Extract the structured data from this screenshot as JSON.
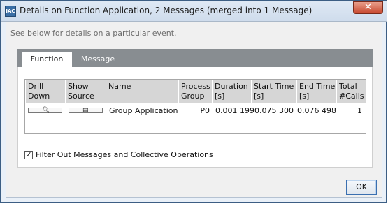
{
  "window": {
    "title": "Details on Function Application, 2 Messages (merged into 1 Message)",
    "app_icon_label": "IAC",
    "close_label": "✕"
  },
  "hint": "See below for details on a particular event.",
  "tabs": [
    {
      "label": "Function",
      "active": true
    },
    {
      "label": "Message",
      "active": false
    }
  ],
  "table": {
    "headers": {
      "drill_down": [
        "Drill",
        "Down"
      ],
      "show_source": [
        "Show",
        "Source"
      ],
      "name": [
        "Name",
        ""
      ],
      "process_group": [
        "Process",
        "Group"
      ],
      "duration": [
        "Duration",
        "[s]"
      ],
      "start_time": [
        "Start Time",
        "[s]"
      ],
      "end_time": [
        "End Time",
        "[s]"
      ],
      "total_calls": [
        "Total",
        "#Calls"
      ]
    },
    "rows": [
      {
        "drill_down_icon": "magnifier-icon",
        "show_source_icon": "document-icon",
        "name": "Group Application",
        "process_group": "P0",
        "duration": "0.001 199",
        "start_time": "0.075 300",
        "end_time": "0.076 498",
        "total_calls": "1"
      }
    ]
  },
  "filter_checkbox": {
    "checked": true,
    "label": "Filter Out Messages and Collective Operations"
  },
  "ok_label": "OK"
}
